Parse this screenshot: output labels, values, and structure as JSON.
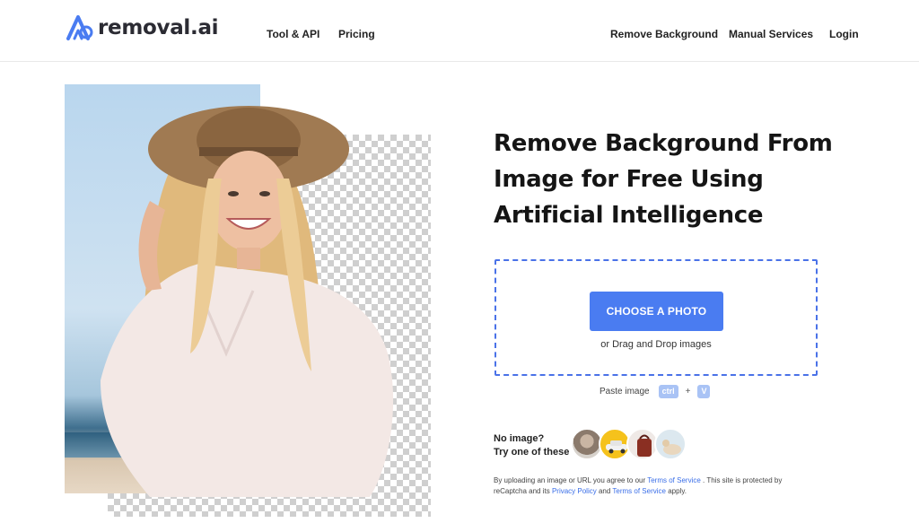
{
  "header": {
    "logo_text": "removal.ai",
    "nav_left": [
      "Tool & API",
      "Pricing"
    ],
    "nav_right": [
      "Remove Background",
      "Manual Services",
      "Login"
    ]
  },
  "hero": {
    "headline_lines": [
      "Remove Background From",
      "Image for Free Using",
      "Artificial Intelligence"
    ]
  },
  "upload": {
    "choose_button": "CHOOSE A PHOTO",
    "drag_text": "or Drag and Drop images",
    "paste_label": "Paste image",
    "paste_key_ctrl": "ctrl",
    "paste_plus": "+",
    "paste_key_v": "V"
  },
  "samples": {
    "line1": "No image?",
    "line2": "Try one of these",
    "thumbnails": [
      "sample-person",
      "sample-car",
      "sample-bag",
      "sample-animal"
    ]
  },
  "legal": {
    "part1": "By uploading an image or URL you agree to our",
    "terms1": "Terms of Service",
    "part2": ". This site is protected by reCaptcha and its",
    "privacy": "Privacy Policy",
    "part3": "and",
    "terms2": "Terms of Service",
    "part4": "apply."
  },
  "colors": {
    "accent": "#4a7cf1",
    "dropzone_border": "#4a72e8",
    "link": "#3a6ee8"
  }
}
